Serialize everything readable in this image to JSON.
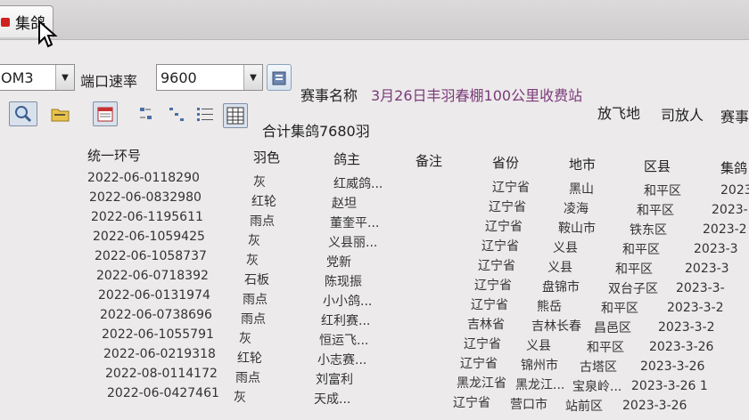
{
  "tab": {
    "label": "集鸽"
  },
  "toolbar": {
    "port_value": "OM3",
    "baud_label": "端口速率",
    "baud_value": "9600",
    "race_label": "赛事名称",
    "race_name": "3月26日丰羽春棚100公里收费站",
    "release_label": "放飞地",
    "releaser_label": "司放人",
    "race_label_2": "赛事",
    "total": "合计集鸽7680羽"
  },
  "table": {
    "headers": [
      "统一环号",
      "羽色",
      "鸽主",
      "备注",
      "省份",
      "地市",
      "区县",
      "集鸽"
    ],
    "rows": [
      [
        "2022-06-0118290",
        "灰",
        "红威鸽...",
        "",
        "辽宁省",
        "黑山",
        "和平区",
        "2023"
      ],
      [
        "2022-06-0832980",
        "红轮",
        "赵坦",
        "",
        "辽宁省",
        "凌海",
        "和平区",
        "2023-"
      ],
      [
        "2022-06-1195611",
        "雨点",
        "董奎平...",
        "",
        "辽宁省",
        "鞍山市",
        "铁东区",
        "2023-2"
      ],
      [
        "2022-06-1059425",
        "灰",
        "义县丽...",
        "",
        "辽宁省",
        "义县",
        "和平区",
        "2023-3"
      ],
      [
        "2022-06-1058737",
        "灰",
        "党新",
        "",
        "辽宁省",
        "义县",
        "和平区",
        "2023-3"
      ],
      [
        "2022-06-0718392",
        "石板",
        "陈现振",
        "",
        "辽宁省",
        "盘锦市",
        "双台子区",
        "2023-3-"
      ],
      [
        "2022-06-0131974",
        "雨点",
        "小小鸽...",
        "",
        "辽宁省",
        "熊岳",
        "和平区",
        "2023-3-2"
      ],
      [
        "2022-06-0738696",
        "雨点",
        "红利赛...",
        "",
        "吉林省",
        "吉林长春",
        "昌邑区",
        "2023-3-2"
      ],
      [
        "2022-06-1055791",
        "灰",
        "恒运飞...",
        "",
        "辽宁省",
        "义县",
        "和平区",
        "2023-3-26"
      ],
      [
        "2022-06-0219318",
        "红轮",
        "小志赛...",
        "",
        "辽宁省",
        "锦州市",
        "古塔区",
        "2023-3-26"
      ],
      [
        "2022-08-0114172",
        "雨点",
        "刘富利",
        "",
        "黑龙江省",
        "黑龙江...",
        "宝泉岭...",
        "2023-3-26 1"
      ],
      [
        "2022-06-0427461",
        "灰",
        "天成...",
        "",
        "辽宁省",
        "营口市",
        "站前区",
        "2023-3-26"
      ]
    ]
  }
}
